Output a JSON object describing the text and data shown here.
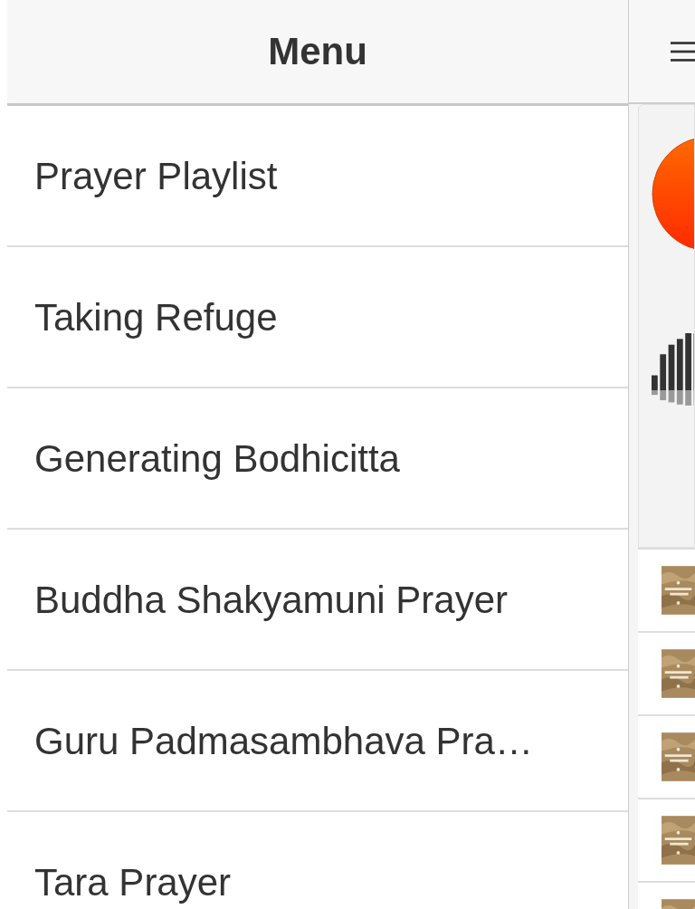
{
  "menu": {
    "title": "Menu",
    "items": [
      {
        "label": "Prayer Playlist"
      },
      {
        "label": "Taking Refuge"
      },
      {
        "label": "Generating Bodhicitta"
      },
      {
        "label": "Buddha Shakyamuni Prayer"
      },
      {
        "label": "Guru Padmasambhava Pra…"
      },
      {
        "label": "Tara Prayer"
      }
    ]
  }
}
